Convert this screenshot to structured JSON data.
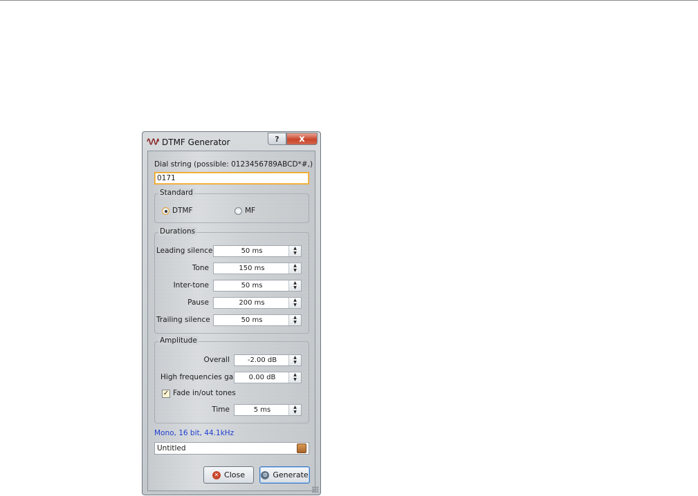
{
  "window": {
    "title": "DTMF Generator",
    "help_label": "?",
    "close_label": "x"
  },
  "dial": {
    "label": "Dial string (possible: 0123456789ABCD*#,)",
    "value": "0171"
  },
  "standard": {
    "title": "Standard",
    "options": [
      "DTMF",
      "MF"
    ],
    "selected": "DTMF"
  },
  "durations": {
    "title": "Durations",
    "rows": [
      {
        "label": "Leading silence",
        "value": "50 ms"
      },
      {
        "label": "Tone",
        "value": "150 ms"
      },
      {
        "label": "Inter-tone",
        "value": "50 ms"
      },
      {
        "label": "Pause",
        "value": "200 ms"
      },
      {
        "label": "Trailing silence",
        "value": "50 ms"
      }
    ]
  },
  "amplitude": {
    "title": "Amplitude",
    "overall_label": "Overall",
    "overall_value": "-2.00 dB",
    "hf_label": "High frequencies gain",
    "hf_value": "0.00 dB",
    "fade_label": "Fade in/out tones",
    "fade_checked": true,
    "time_label": "Time",
    "time_value": "5 ms"
  },
  "format_text": "Mono, 16 bit, 44.1kHz",
  "output_name": "Untitled",
  "buttons": {
    "close": "Close",
    "generate": "Generate"
  },
  "colors": {
    "status_blue": "#1f3fd0",
    "focus_orange": "#f0a020",
    "close_red": "#c9462b"
  }
}
